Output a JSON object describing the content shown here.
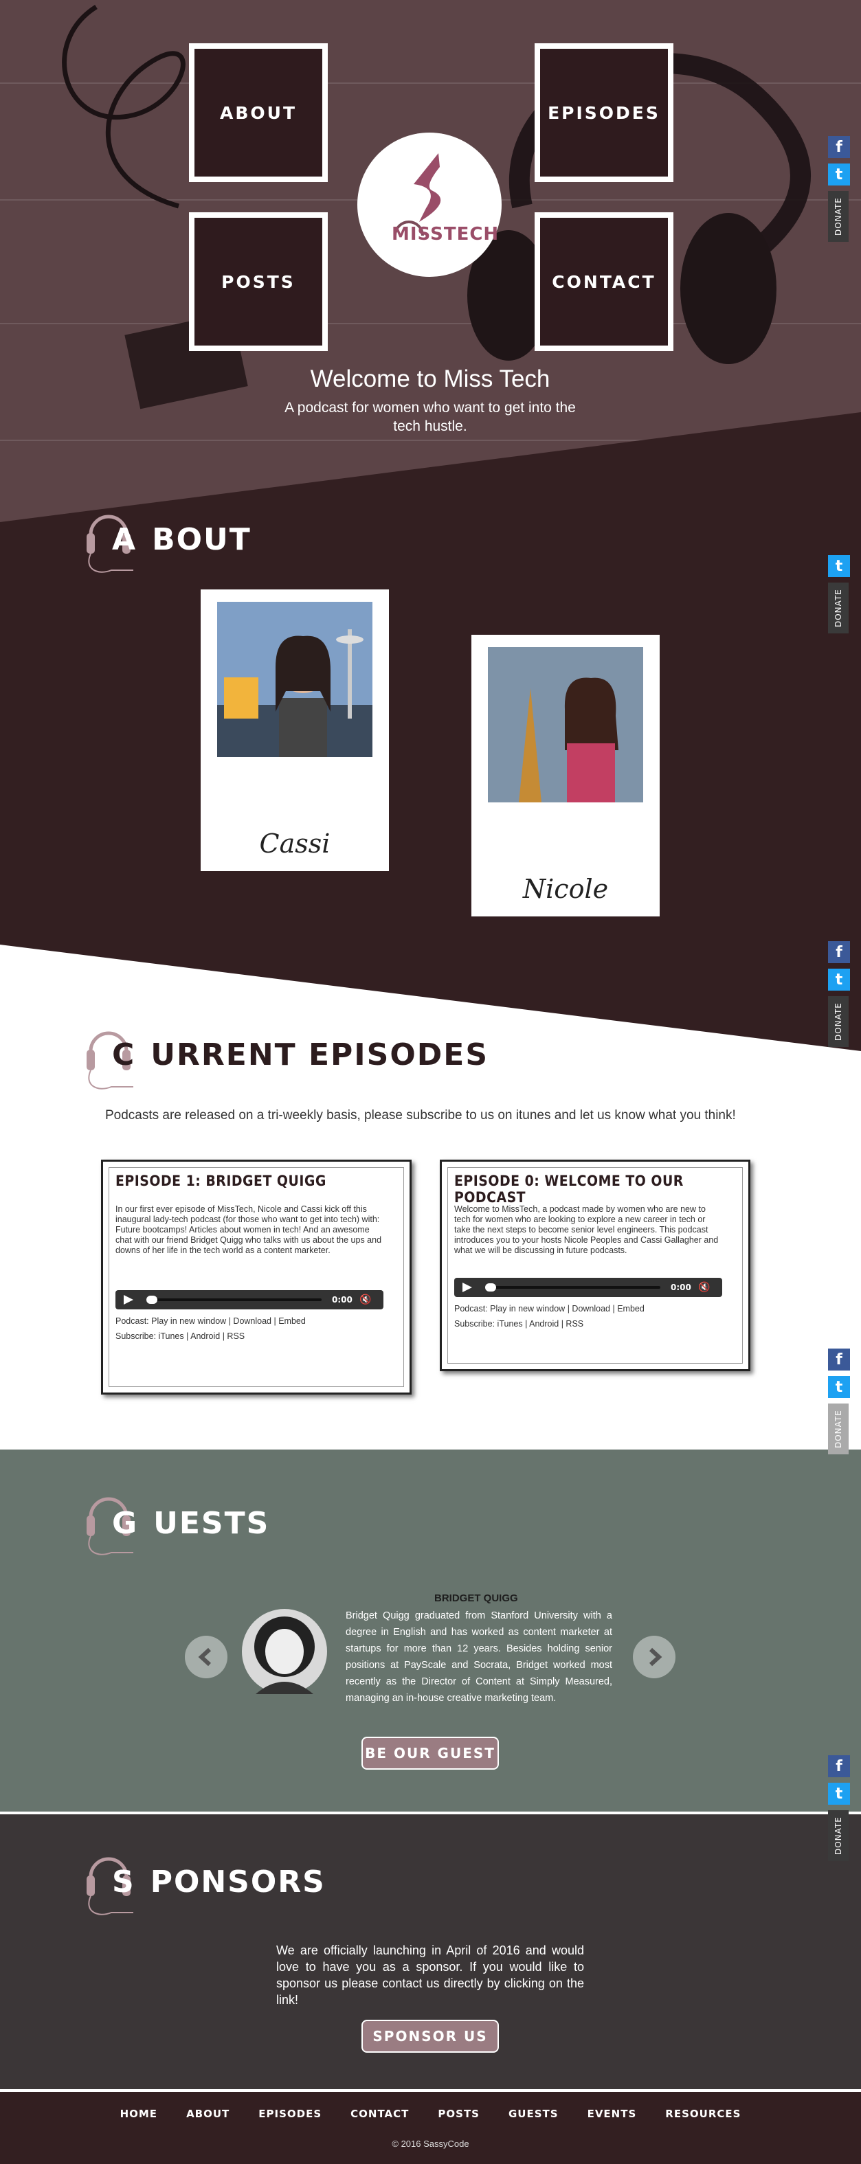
{
  "nav": {
    "about": "ABOUT",
    "episodes": "EPISODES",
    "posts": "POSTS",
    "contact": "CONTACT"
  },
  "logo": {
    "text_m": "M",
    "text_rest": "ISSTECH"
  },
  "hero": {
    "title": "Welcome to Miss Tech",
    "subtitle": "A podcast for women who want to get into the tech hustle."
  },
  "social": {
    "facebook": "f",
    "twitter": "t",
    "donate": "DONATE"
  },
  "about": {
    "title_initial": "A",
    "title_rest": "BOUT",
    "hosts": [
      "Cassi",
      "Nicole"
    ]
  },
  "episodes": {
    "title_initial": "C",
    "title_rest": "URRENT EPISODES",
    "intro": "Podcasts are released on a tri-weekly basis, please subscribe to us on itunes and let us know what you think!",
    "items": [
      {
        "title": "EPISODE 1: BRIDGET QUIGG",
        "body": "In our first ever episode of MissTech, Nicole and Cassi kick off this inaugural lady-tech podcast (for those who want to get into tech) with: Future bootcamps! Articles about women in tech! And an awesome chat with our friend Bridget Quigg who talks with us about the ups and downs of her life in the tech world as a content marketer.",
        "time": "0:00",
        "podcast_label": "Podcast:",
        "play": "Play in new window",
        "download": "Download",
        "embed": "Embed",
        "subscribe_label": "Subscribe:",
        "itunes": "iTunes",
        "android": "Android",
        "rss": "RSS"
      },
      {
        "title": "EPISODE 0: WELCOME TO OUR PODCAST",
        "body": "Welcome to MissTech, a podcast made by women who are new to tech for women who are looking to explore a new career in tech or take the next steps to become senior level engineers. This podcast introduces you to your hosts Nicole Peoples and Cassi Gallagher and what we will be discussing in future podcasts.",
        "time": "0:00",
        "podcast_label": "Podcast:",
        "play": "Play in new window",
        "download": "Download",
        "embed": "Embed",
        "subscribe_label": "Subscribe:",
        "itunes": "iTunes",
        "android": "Android",
        "rss": "RSS"
      }
    ]
  },
  "guests": {
    "title_initial": "G",
    "title_rest": "UESTS",
    "guest_name": "BRIDGET QUIGG",
    "guest_bio": "Bridget Quigg graduated from Stanford University with a degree in English and has worked as content marketer at startups for more than 12 years. Besides holding senior positions at PayScale and Socrata, Bridget worked most recently as the Director of Content at Simply Measured, managing an in-house creative marketing team.",
    "button": "BE OUR GUEST"
  },
  "sponsors": {
    "title_initial": "S",
    "title_rest": "PONSORS",
    "text": "We are officially launching in April of 2016 and would love to have you as a sponsor. If you would like to sponsor us please contact us directly by clicking on the link!",
    "button": "SPONSOR US"
  },
  "footer": {
    "links": [
      "HOME",
      "ABOUT",
      "EPISODES",
      "CONTACT",
      "POSTS",
      "GUESTS",
      "EVENTS",
      "RESOURCES"
    ],
    "copyright": "© 2016 SassyCode"
  },
  "colors": {
    "maroon": "#331f21",
    "hero": "#5c4447",
    "sage": "#67746d",
    "charcoal": "#3b3637",
    "mauve": "#9a7c82"
  }
}
